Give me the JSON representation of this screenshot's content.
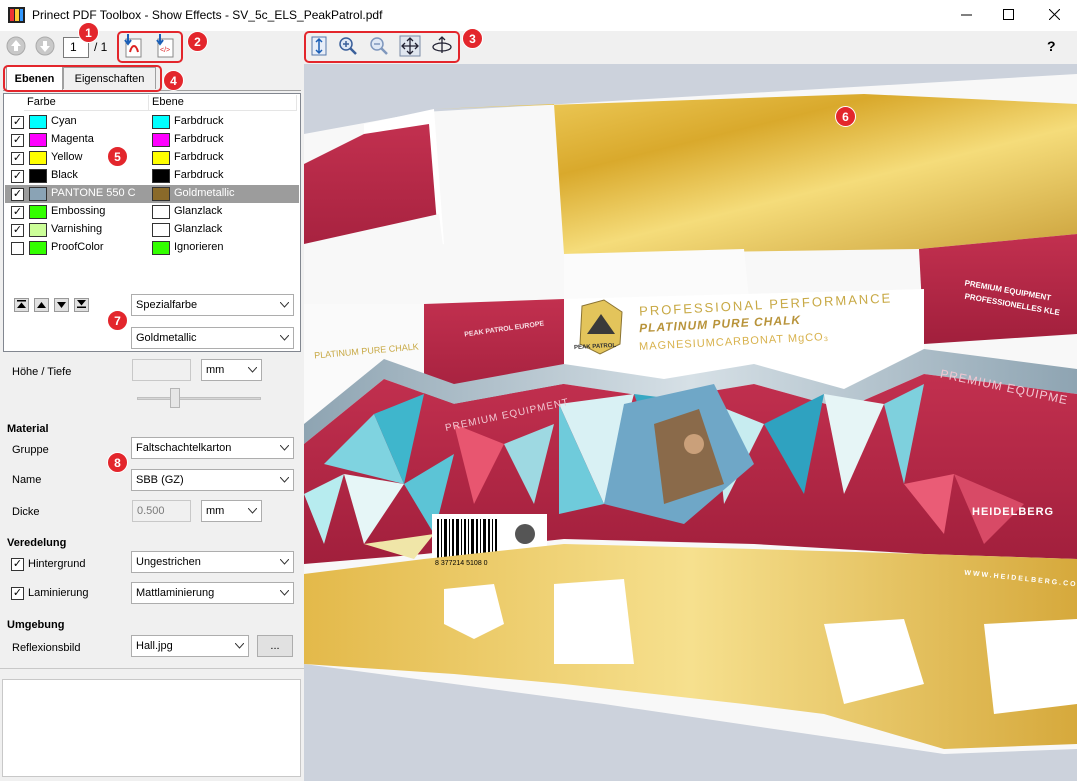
{
  "window": {
    "title": "Prinect PDF Toolbox - Show Effects  - SV_5c_ELS_PeakPatrol.pdf",
    "minimize_icon": "minimize-icon",
    "maximize_icon": "maximize-icon",
    "close_icon": "close-icon"
  },
  "toolbar": {
    "page_current": "1",
    "page_total": "/ 1",
    "help_label": "?"
  },
  "badges": [
    "1",
    "2",
    "3",
    "4",
    "5",
    "6",
    "7",
    "8"
  ],
  "tabs": [
    {
      "label": "Ebenen",
      "active": true
    },
    {
      "label": "Eigenschaften",
      "active": false
    }
  ],
  "layers": {
    "headers": [
      "Farbe",
      "Ebene"
    ],
    "rows": [
      {
        "checked": true,
        "color": "#00ffff",
        "name": "Cyan",
        "layer_color": "#00ffff",
        "layer": "Farbdruck",
        "selected": false
      },
      {
        "checked": true,
        "color": "#ff00ff",
        "name": "Magenta",
        "layer_color": "#ff00ff",
        "layer": "Farbdruck",
        "selected": false
      },
      {
        "checked": true,
        "color": "#ffff00",
        "name": "Yellow",
        "layer_color": "#ffff00",
        "layer": "Farbdruck",
        "selected": false
      },
      {
        "checked": true,
        "color": "#000000",
        "name": "Black",
        "layer_color": "#000000",
        "layer": "Farbdruck",
        "selected": false
      },
      {
        "checked": true,
        "color": "#8aa3b5",
        "name": "PANTONE 550 C",
        "layer_color": "#8a6a2a",
        "layer": "Goldmetallic",
        "selected": true
      },
      {
        "checked": true,
        "color": "#33ff00",
        "name": "Embossing",
        "layer_color": "#ffffff",
        "layer": "Glanzlack",
        "selected": false
      },
      {
        "checked": true,
        "color": "#ccff99",
        "name": "Varnishing",
        "layer_color": "#ffffff",
        "layer": "Glanzlack",
        "selected": false
      },
      {
        "checked": false,
        "color": "#33ff00",
        "name": "ProofColor",
        "layer_color": "#33ff00",
        "layer": "Ignorieren",
        "selected": false
      }
    ]
  },
  "properties": {
    "type_value": "Spezialfarbe",
    "effect_value": "Goldmetallic",
    "height_label": "Höhe / Tiefe",
    "height_value": "",
    "height_unit": "mm",
    "material_section": "Material",
    "group_label": "Gruppe",
    "group_value": "Faltschachtelkarton",
    "name_label": "Name",
    "name_value": "SBB (GZ)",
    "thickness_label": "Dicke",
    "thickness_value": "0.500",
    "thickness_unit": "mm",
    "finishing_section": "Veredelung",
    "background_label": "Hintergrund",
    "background_checked": true,
    "background_value": "Ungestrichen",
    "lamination_label": "Laminierung",
    "lamination_checked": true,
    "lamination_value": "Mattlaminierung",
    "environment_section": "Umgebung",
    "reflection_label": "Reflexionsbild",
    "reflection_value": "Hall.jpg",
    "browse_label": "..."
  },
  "preview": {
    "box_text": {
      "brand": "PEAK PATROL",
      "line1": "PROFESSIONAL PERFORMANCE",
      "line2": "PLATINUM PURE CHALK",
      "line3": "MAGNESIUMCARBONAT MgCO₃",
      "right1": "PREMIUM EQUIPMENT",
      "right2": "PROFESSIONELLES KLE",
      "premium_left": "PREMIUM EQUIPMENT",
      "premium_right": "PREMIUM EQUIPME",
      "heidelberg": "HEIDELBERG",
      "website": "WWW.HEIDELBERG.COM",
      "barcode_number": "8 377214 5108 0",
      "left_chalk": "PLATINUM PURE CHALK",
      "peak_europe": "PEAK PATROL EUROPE"
    },
    "colors": {
      "gold": "#e2b93b",
      "crimson": "#b82848",
      "white": "#ffffff",
      "background": "#ccd2dc"
    }
  }
}
